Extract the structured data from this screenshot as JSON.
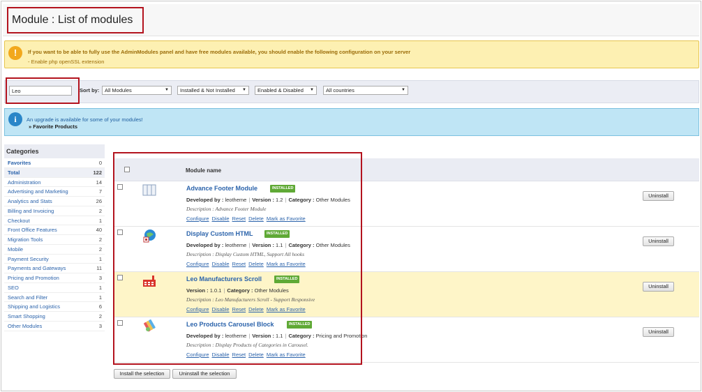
{
  "page": {
    "title": "Module : List of modules"
  },
  "warning": {
    "message": "If you want to be able to fully use the AdminModules panel and have free modules available, you should enable the following configuration on your server",
    "detail": "- Enable php openSSL extension"
  },
  "filters": {
    "search_value": "Leo",
    "sort_label": "Sort by:",
    "selects": [
      "All Modules",
      "Installed & Not Installed",
      "Enabled & Disabled",
      "All countries"
    ]
  },
  "upgrade": {
    "message": "An upgrade is available for some of your modules!",
    "item": "» Favorite Products"
  },
  "categories": {
    "heading": "Categories",
    "items": [
      {
        "name": "Favorites",
        "count": "0"
      },
      {
        "name": "Total",
        "count": "122"
      },
      {
        "name": "Administration",
        "count": "14"
      },
      {
        "name": "Advertising and Marketing",
        "count": "7"
      },
      {
        "name": "Analytics and Stats",
        "count": "26"
      },
      {
        "name": "Billing and Invoicing",
        "count": "2"
      },
      {
        "name": "Checkout",
        "count": "1"
      },
      {
        "name": "Front Office Features",
        "count": "40"
      },
      {
        "name": "Migration Tools",
        "count": "2"
      },
      {
        "name": "Mobile",
        "count": "2"
      },
      {
        "name": "Payment Security",
        "count": "1"
      },
      {
        "name": "Payments and Gateways",
        "count": "11"
      },
      {
        "name": "Pricing and Promotion",
        "count": "3"
      },
      {
        "name": "SEO",
        "count": "1"
      },
      {
        "name": "Search and Filter",
        "count": "1"
      },
      {
        "name": "Shipping and Logistics",
        "count": "6"
      },
      {
        "name": "Smart Shopping",
        "count": "2"
      },
      {
        "name": "Other Modules",
        "count": "3"
      }
    ]
  },
  "modules": {
    "column_header": "Module name",
    "badge": "INSTALLED",
    "labels": {
      "developed_by": "Developed by :",
      "version": "Version :",
      "category": "Category :"
    },
    "actions": [
      "Configure",
      "Disable",
      "Reset",
      "Delete",
      "Mark as Favorite"
    ],
    "uninstall_label": "Uninstall",
    "rows": [
      {
        "name": "Advance Footer Module",
        "author": "leotheme",
        "version": "1.2",
        "category": "Other Modules",
        "description": "Description : Advance Footer Module",
        "icon": "grid-icon"
      },
      {
        "name": "Display Custom HTML",
        "author": "leotheme",
        "version": "1.1",
        "category": "Other Modules",
        "description": "Description : Display Custom HTML, Support All hooks",
        "icon": "html-globe-icon"
      },
      {
        "name": "Leo Manufacturers Scroll",
        "version": "1.0.1",
        "category": "Other Modules",
        "description": "Description : Leo Manufacturers Scroll - Support Responsive",
        "icon": "factory-icon"
      },
      {
        "name": "Leo Products Carousel Block",
        "author": "leotheme",
        "version": "1.1",
        "category": "Pricing and Promotion",
        "description": "Description : Display Products of Categories in Carousel.",
        "icon": "palette-icon"
      }
    ]
  },
  "bottom_actions": {
    "install_selection": "Install the selection",
    "uninstall_selection": "Uninstall the selection"
  },
  "colors": {
    "link": "#2b63ab",
    "highlight_border": "#b3131e",
    "installed_badge": "#5fa935",
    "warning_bg": "#fdf0b2",
    "info_bg": "#bfe5f5",
    "selected_row_bg": "#fef5c8"
  }
}
